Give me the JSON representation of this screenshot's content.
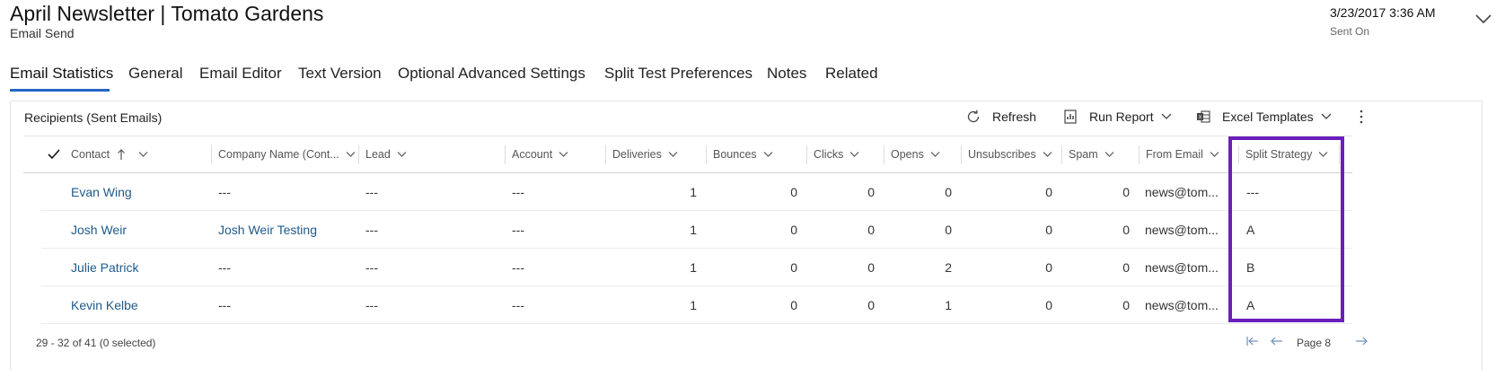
{
  "header": {
    "title": "April Newsletter | Tomato Gardens",
    "subtitle": "Email Send",
    "sent_on_value": "3/23/2017 3:36 AM",
    "sent_on_label": "Sent On"
  },
  "tabs": [
    {
      "label": "Email Statistics",
      "active": true
    },
    {
      "label": "General"
    },
    {
      "label": "Email Editor"
    },
    {
      "label": "Text Version"
    },
    {
      "label": "Optional Advanced Settings"
    },
    {
      "label": "Split Test Preferences"
    },
    {
      "label": "Notes"
    },
    {
      "label": "Related"
    }
  ],
  "subgrid": {
    "title": "Recipients (Sent Emails)",
    "commands": {
      "refresh": "Refresh",
      "run_report": "Run Report",
      "excel_templates": "Excel Templates"
    },
    "columns": [
      "Contact",
      "Company Name (Cont...",
      "Lead",
      "Account",
      "Deliveries",
      "Bounces",
      "Clicks",
      "Opens",
      "Unsubscribes",
      "Spam",
      "From Email",
      "Split Strategy"
    ],
    "rows": [
      [
        "Evan Wing",
        "---",
        "---",
        "---",
        "1",
        "0",
        "0",
        "0",
        "0",
        "0",
        "news@tom...",
        "---"
      ],
      [
        "Josh Weir",
        "Josh Weir Testing",
        "---",
        "---",
        "1",
        "0",
        "0",
        "0",
        "0",
        "0",
        "news@tom...",
        "A"
      ],
      [
        "Julie Patrick",
        "---",
        "---",
        "---",
        "1",
        "0",
        "0",
        "2",
        "0",
        "0",
        "news@tom...",
        "B"
      ],
      [
        "Kevin Kelbe",
        "---",
        "---",
        "---",
        "1",
        "0",
        "0",
        "1",
        "0",
        "0",
        "news@tom...",
        "A"
      ]
    ],
    "footer": {
      "record_count": "29 - 32 of 41 (0 selected)",
      "page_label": "Page 8"
    }
  },
  "colors": {
    "accent": "#2266c4",
    "highlight": "#6a1fbd",
    "link": "#1f5a8a"
  }
}
